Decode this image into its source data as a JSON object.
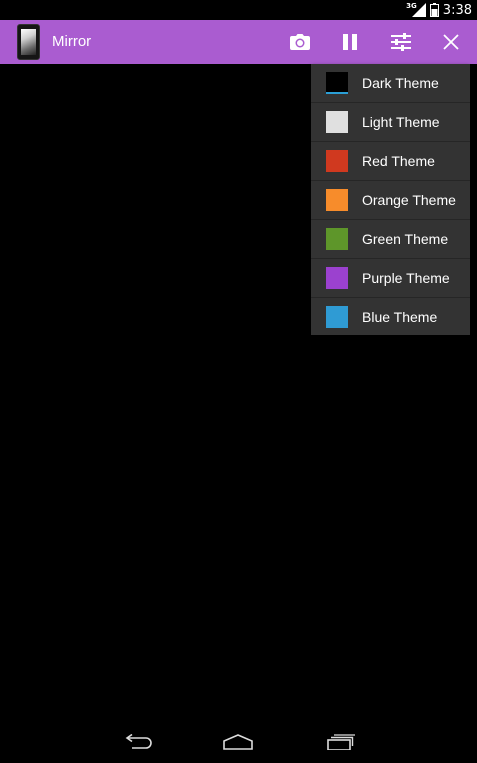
{
  "status_bar": {
    "network_type": "3G",
    "time": "3:38"
  },
  "action_bar": {
    "title": "Mirror",
    "background_color": "#aa5cd0",
    "actions": [
      "camera-icon",
      "pause-icon",
      "tune-icon",
      "close-icon"
    ]
  },
  "theme_menu": {
    "items": [
      {
        "label": "Dark Theme",
        "color": "#000000"
      },
      {
        "label": "Light Theme",
        "color": "#e0e0e0"
      },
      {
        "label": "Red Theme",
        "color": "#d0391f"
      },
      {
        "label": "Orange Theme",
        "color": "#f78c2b"
      },
      {
        "label": "Green Theme",
        "color": "#5e962a"
      },
      {
        "label": "Purple Theme",
        "color": "#9b41cf"
      },
      {
        "label": "Blue Theme",
        "color": "#2f9bd4"
      }
    ]
  },
  "nav_bar": {
    "buttons": [
      "back-icon",
      "home-icon",
      "recent-apps-icon"
    ]
  }
}
